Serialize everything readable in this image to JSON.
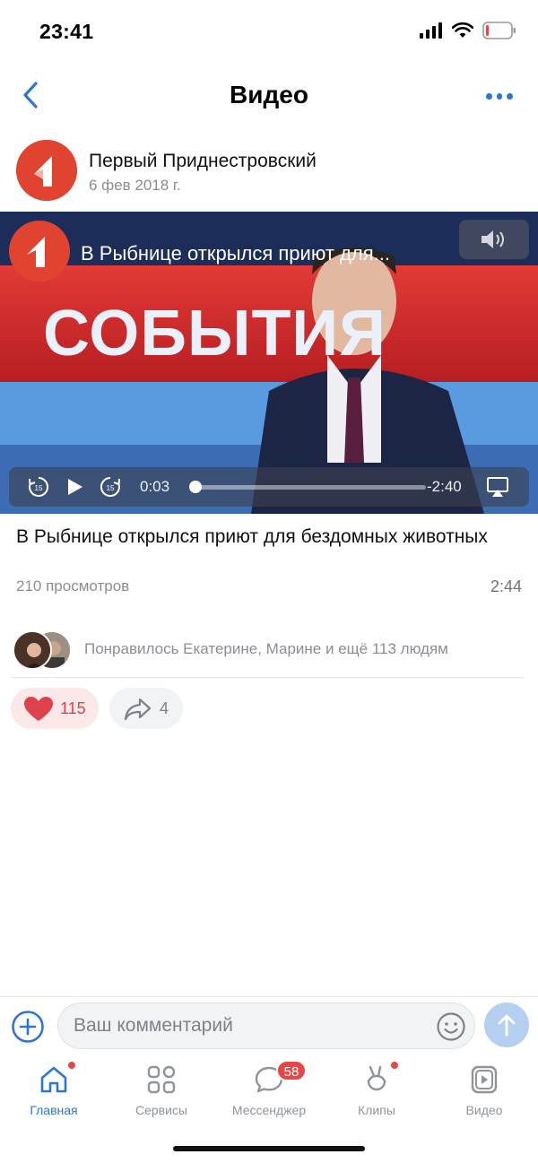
{
  "status_bar": {
    "time": "23:41"
  },
  "nav": {
    "title": "Видео"
  },
  "channel": {
    "name": "Первый Приднестровский",
    "date": "6 фев 2018 г."
  },
  "video": {
    "overlay_title": "В Рыбнице открылся приют для...",
    "banner_text": "СОБЫТИЯ",
    "elapsed": "0:03",
    "remaining": "-2:40",
    "progress_fraction": 0.02,
    "skip_seconds": "15"
  },
  "post": {
    "title": "В Рыбнице открылся приют для бездомных животных",
    "views": "210 просмотров",
    "duration": "2:44"
  },
  "likes": {
    "text": "Понравилось Екатерине, Марине и ещё 113 людям",
    "like_count": "115",
    "share_count": "4"
  },
  "comment": {
    "placeholder": "Ваш комментарий"
  },
  "tabs": [
    {
      "label": "Главная",
      "icon": "home-icon",
      "active": true,
      "dot": true
    },
    {
      "label": "Сервисы",
      "icon": "grid-icon",
      "active": false
    },
    {
      "label": "Мессенджер",
      "icon": "chat-icon",
      "active": false,
      "badge": "58"
    },
    {
      "label": "Клипы",
      "icon": "clips-icon",
      "active": false,
      "dot": true
    },
    {
      "label": "Видео",
      "icon": "video-icon",
      "active": false
    }
  ],
  "colors": {
    "accent": "#2f76d2",
    "like": "#e0424c",
    "badge": "#e64646"
  }
}
